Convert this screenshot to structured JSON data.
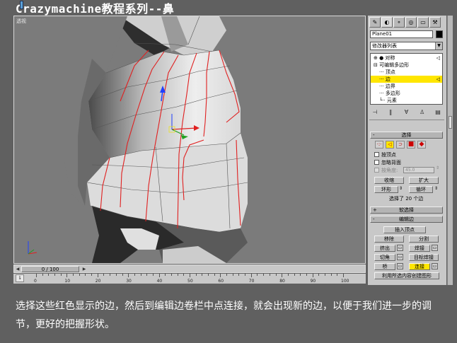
{
  "title": "Crazymachine教程系列--鼻",
  "viewport": {
    "label": "透视"
  },
  "timeline": {
    "slider_text": "0 / 100",
    "ruler_ticks": [
      "0",
      "10",
      "20",
      "30",
      "40",
      "50",
      "60",
      "70",
      "80",
      "90",
      "100"
    ]
  },
  "panel": {
    "tabs": [
      {
        "icon": "create-icon",
        "glyph": "✎"
      },
      {
        "icon": "modify-icon",
        "glyph": "◐"
      },
      {
        "icon": "hierarchy-icon",
        "glyph": "⚬"
      },
      {
        "icon": "motion-icon",
        "glyph": "◎"
      },
      {
        "icon": "display-icon",
        "glyph": "▭"
      },
      {
        "icon": "utilities-icon",
        "glyph": "⚒"
      }
    ],
    "object_name": "Plane01",
    "object_color": "#000000",
    "modifier_list": "修改器列表",
    "stack": [
      {
        "label": "对称",
        "prefix": "⊕ ● ",
        "indent": 4,
        "selected": false,
        "corner": "◁"
      },
      {
        "label": "可编辑多边形",
        "prefix": "⊟ ",
        "indent": 4,
        "selected": false,
        "corner": ""
      },
      {
        "label": "顶点",
        "prefix": "··· ",
        "indent": 12,
        "selected": false,
        "corner": ""
      },
      {
        "label": "边",
        "prefix": "··· ",
        "indent": 12,
        "selected": true,
        "corner": "◁"
      },
      {
        "label": "边界",
        "prefix": "··· ",
        "indent": 12,
        "selected": false,
        "corner": ""
      },
      {
        "label": "多边形",
        "prefix": "··· ",
        "indent": 12,
        "selected": false,
        "corner": ""
      },
      {
        "label": "元素",
        "prefix": "└·· ",
        "indent": 12,
        "selected": false,
        "corner": ""
      }
    ],
    "stack_buttons": [
      {
        "icon": "pin-stack-icon",
        "glyph": "⊣"
      },
      {
        "icon": "show-end-result-icon",
        "glyph": "‖"
      },
      {
        "icon": "make-unique-icon",
        "glyph": "∀"
      },
      {
        "icon": "remove-modifier-icon",
        "glyph": "♙"
      },
      {
        "icon": "configure-sets-icon",
        "glyph": "▤"
      }
    ],
    "selection": {
      "header": "选择",
      "by_vertex": "按顶点",
      "ignore_backfacing": "忽略背面",
      "by_angle": "按角度:",
      "angle_value": "45.0",
      "shrink": "收缩",
      "grow": "扩大",
      "ring": "环形",
      "loop": "循环",
      "status": "选择了 20 个边"
    },
    "soft_selection": {
      "header": "软选择"
    },
    "edit_edges": {
      "header": "编辑边",
      "insert_vertex": "插入顶点",
      "remove": "移除",
      "split": "分割",
      "extrude": "挤出",
      "weld": "焊接",
      "chamfer": "切角",
      "target_weld": "目标焊接",
      "bridge": "桥",
      "connect": "连接",
      "create_shape": "利用所选内容创建图形"
    }
  },
  "caption": "选择这些红色显示的边，然后到编辑边卷栏中点连接，就会出现新的边，以便于我们进一步的调节，更好的把握形状。"
}
